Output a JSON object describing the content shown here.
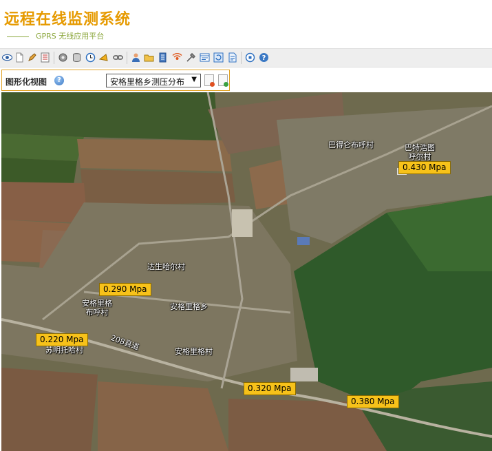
{
  "header": {
    "title": "远程在线监测系统",
    "subtitle": "GPRS 无线应用平台",
    "title_color": "#e69a00",
    "subtitle_color": "#8aa63a"
  },
  "toolbar": {
    "icons": [
      "eye-icon",
      "new-document-icon",
      "edit-icon",
      "list-icon",
      "settings-icon",
      "database-icon",
      "clock-icon",
      "alarm-icon",
      "link-icon",
      "user-icon",
      "folder-icon",
      "report-icon",
      "signal-icon",
      "tools-icon",
      "form-icon",
      "refresh-icon",
      "document-icon",
      "stop-icon",
      "help-icon"
    ]
  },
  "panel": {
    "title": "图形化视图",
    "selected_view": "安格里格乡测压分布",
    "accent": "#e0a020"
  },
  "map": {
    "place_labels": [
      {
        "id": "bade",
        "text": "巴得仑布呼村"
      },
      {
        "id": "bate",
        "text": "巴特浩图\n呼尔村"
      },
      {
        "id": "dasheng",
        "text": "达生哈尔村"
      },
      {
        "id": "angelige_bu",
        "text": "安格里格\n布呼村"
      },
      {
        "id": "angelige_xiang",
        "text": "安格里格乡"
      },
      {
        "id": "suming",
        "text": "苏明托哈村"
      },
      {
        "id": "road208",
        "text": "208县道"
      },
      {
        "id": "angelige_cun",
        "text": "安格里格村"
      }
    ],
    "pressure_readings": [
      {
        "id": "p1",
        "value": "0.430 Mpa"
      },
      {
        "id": "p2",
        "value": "0.290 Mpa"
      },
      {
        "id": "p3",
        "value": "0.220 Mpa"
      },
      {
        "id": "p4",
        "value": "0.320 Mpa"
      },
      {
        "id": "p5",
        "value": "0.380 Mpa"
      }
    ],
    "badge_color": "#f7c21a"
  }
}
